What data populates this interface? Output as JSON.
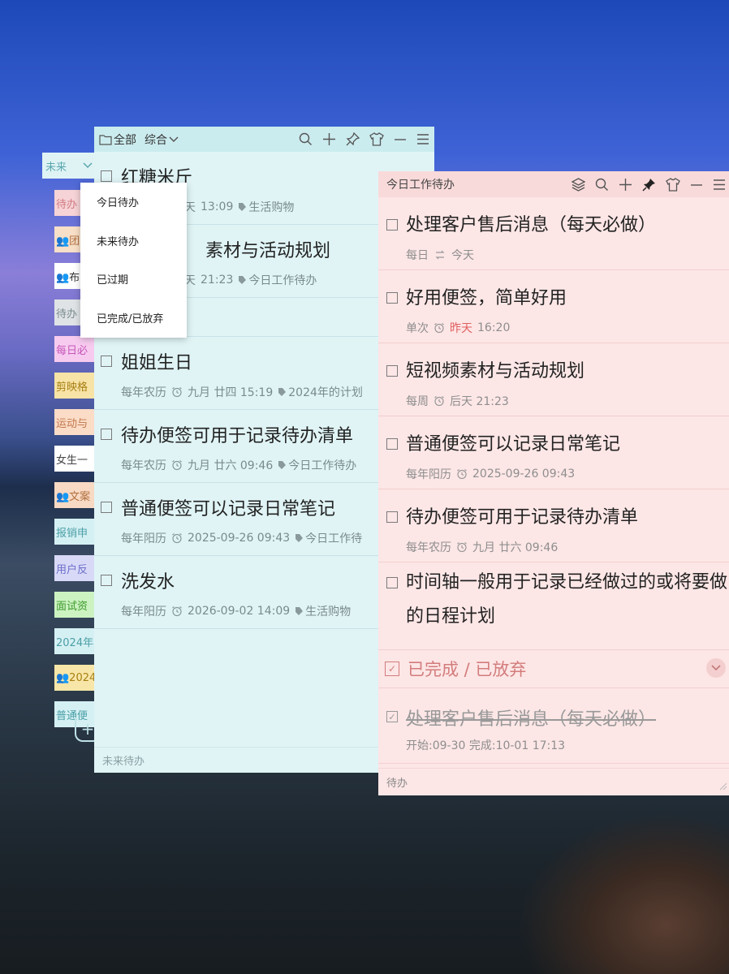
{
  "tabstrip": {
    "head_label": "未来",
    "tabs": [
      {
        "label": "待办",
        "bg": "#f6d3d6",
        "color": "#d07c84"
      },
      {
        "label": "👥团",
        "bg": "#f8dfc8",
        "color": "#b07040"
      },
      {
        "label": "👥布",
        "bg": "#ffffff",
        "color": "#333333"
      },
      {
        "label": "待办",
        "bg": "#dfe3e6",
        "color": "#7a8a8e"
      },
      {
        "label": "每日必",
        "bg": "#f7cbf0",
        "color": "#c657b9"
      },
      {
        "label": "剪映格",
        "bg": "#f8e3a6",
        "color": "#a67f14"
      },
      {
        "label": "运动与",
        "bg": "#fbdcc7",
        "color": "#c2774a"
      },
      {
        "label": "女生一",
        "bg": "#ffffff",
        "color": "#444444"
      },
      {
        "label": "👥文案",
        "bg": "#f8d9c3",
        "color": "#b07040"
      },
      {
        "label": "报销申",
        "bg": "#d5f0f3",
        "color": "#4a9fa7"
      },
      {
        "label": "用户反",
        "bg": "#d8d9f7",
        "color": "#6c6ec9"
      },
      {
        "label": "面试资",
        "bg": "#ccf2c2",
        "color": "#3d9a2c"
      },
      {
        "label": "2024年",
        "bg": "#d5f0f3",
        "color": "#4a9fa7"
      },
      {
        "label": "👥2024",
        "bg": "#f8e6a8",
        "color": "#a67f14"
      },
      {
        "label": "普通便",
        "bg": "#d5f0f3",
        "color": "#4a9fa7"
      }
    ]
  },
  "dropdown": {
    "options": [
      "今日待办",
      "未来待办",
      "已过期",
      "已完成/已放弃"
    ]
  },
  "window_left": {
    "folder_label": "全部",
    "view_label": "综合",
    "items": [
      {
        "title": "红糖米斤",
        "meta": [
          "天",
          "13:09",
          "生活购物"
        ]
      },
      {
        "title": "素材与活动规划",
        "meta": [
          "天",
          "21:23",
          "今日工作待办"
        ]
      },
      {
        "title": "",
        "meta": []
      },
      {
        "title": "姐姐生日",
        "meta": [
          "每年农历",
          "九月 廿四 15:19",
          "2024年的计划"
        ]
      },
      {
        "title": "待办便签可用于记录待办清单",
        "meta": [
          "每年农历",
          "九月 廿六 09:46",
          "今日工作待办"
        ]
      },
      {
        "title": "普通便签可以记录日常笔记",
        "meta": [
          "每年阳历",
          "2025-09-26 09:43",
          "今日工作待"
        ]
      },
      {
        "title": "洗发水",
        "meta": [
          "每年阳历",
          "2026-09-02 14:09",
          "生活购物"
        ]
      }
    ],
    "footer": "未来待办"
  },
  "window_right": {
    "title": "今日工作待办",
    "items": [
      {
        "title": "处理客户售后消息（每天必做）",
        "repeat": "每日",
        "date": "今天"
      },
      {
        "title": "好用便签，简单好用",
        "repeat": "单次",
        "date_red": "昨天",
        "date": "16:20"
      },
      {
        "title": "短视频素材与活动规划",
        "repeat": "每周",
        "date": "后天 21:23"
      },
      {
        "title": "普通便签可以记录日常笔记",
        "repeat": "每年阳历",
        "date": "2025-09-26 09:43"
      },
      {
        "title": "待办便签可用于记录待办清单",
        "repeat": "每年农历",
        "date": "九月 廿六 09:46"
      }
    ],
    "tall_item": {
      "title": "时间轴一般用于记录已经做过的或将要做的日程计划"
    },
    "completed_section": "已完成 / 已放弃",
    "done_item": {
      "title": "处理客户售后消息（每天必做）",
      "meta": "开始:09-30 完成:10-01 17:13"
    },
    "footer": "待办"
  }
}
